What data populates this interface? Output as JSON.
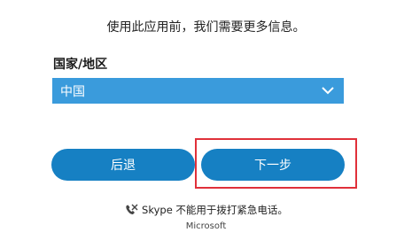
{
  "intro_text": "使用此应用前，我们需要更多信息。",
  "country": {
    "label": "国家/地区",
    "selected_value": "中国"
  },
  "buttons": {
    "back_label": "后退",
    "next_label": "下一步"
  },
  "notice_text": "Skype 不能用于拨打紧急电话。",
  "footer_text": "Microsoft",
  "colors": {
    "select_bg": "#3a9bdc",
    "button_bg": "#1680c3",
    "highlight_border": "#e0303a"
  },
  "icons": {
    "select": "chevron-down-icon",
    "notice": "no-emergency-call-icon"
  }
}
